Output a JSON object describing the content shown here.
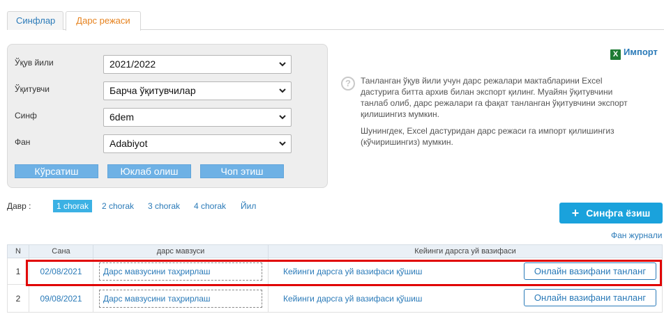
{
  "tabs": [
    {
      "label": "Синфлар"
    },
    {
      "label": "Дарс режаси"
    }
  ],
  "filters": {
    "year": {
      "label": "Ўқув йили",
      "value": "2021/2022"
    },
    "teacher": {
      "label": "Ўқитувчи",
      "value": "Барча ўқитувчилар"
    },
    "class": {
      "label": "Синф",
      "value": "6dem"
    },
    "subject": {
      "label": "Фан",
      "value": "Adabiyot"
    },
    "buttons": {
      "show": "Кўрсатиш",
      "download": "Юклаб олиш",
      "print": "Чоп этиш"
    }
  },
  "import": {
    "label": "Импорт",
    "icon": "excel-icon"
  },
  "help": {
    "paragraph1": "Танланган ўқув йили учун дарс режалари мактабларини Excel дастурига битта архив билан экспорт қилинг. Муайян ўқитувчини танлаб олиб, дарс режалари га фақат танланган ўқитувчини экспорт қилишингиз мумкин.",
    "paragraph2": "Шунингдек, Excel дастуридан дарс режаси га импорт қилишингиз (кўчиришингиз) мумкин."
  },
  "period": {
    "label": "Давр :",
    "items": [
      "1 chorak",
      "2 chorak",
      "3 chorak",
      "4 chorak",
      "Йил"
    ],
    "active_index": 0
  },
  "add_class_button": "Синфга ёзиш",
  "journal_link": "Фан журнали",
  "table": {
    "headers": {
      "n": "N",
      "date": "Сана",
      "topic": "дарс мавзуси",
      "homework": "Кейинги дарсга уй вазифаси"
    },
    "rows": [
      {
        "n": "1",
        "date": "02/08/2021",
        "topic": "Дарс мавзусини таҳрирлаш",
        "homework": "Кейинги дарсга уй вазифаси қўшиш",
        "online": "Онлайн вазифани танланг"
      },
      {
        "n": "2",
        "date": "09/08/2021",
        "topic": "Дарс мавзусини таҳрирлаш",
        "homework": "Кейинги дарсга уй вазифаси қўшиш",
        "online": "Онлайн вазифани танланг"
      }
    ]
  },
  "colors": {
    "accent": "#2a7ab8",
    "active_tab": "#e6821e",
    "period_active": "#3bb1e4",
    "add_button": "#1aa2dc",
    "highlight": "#e00000"
  }
}
